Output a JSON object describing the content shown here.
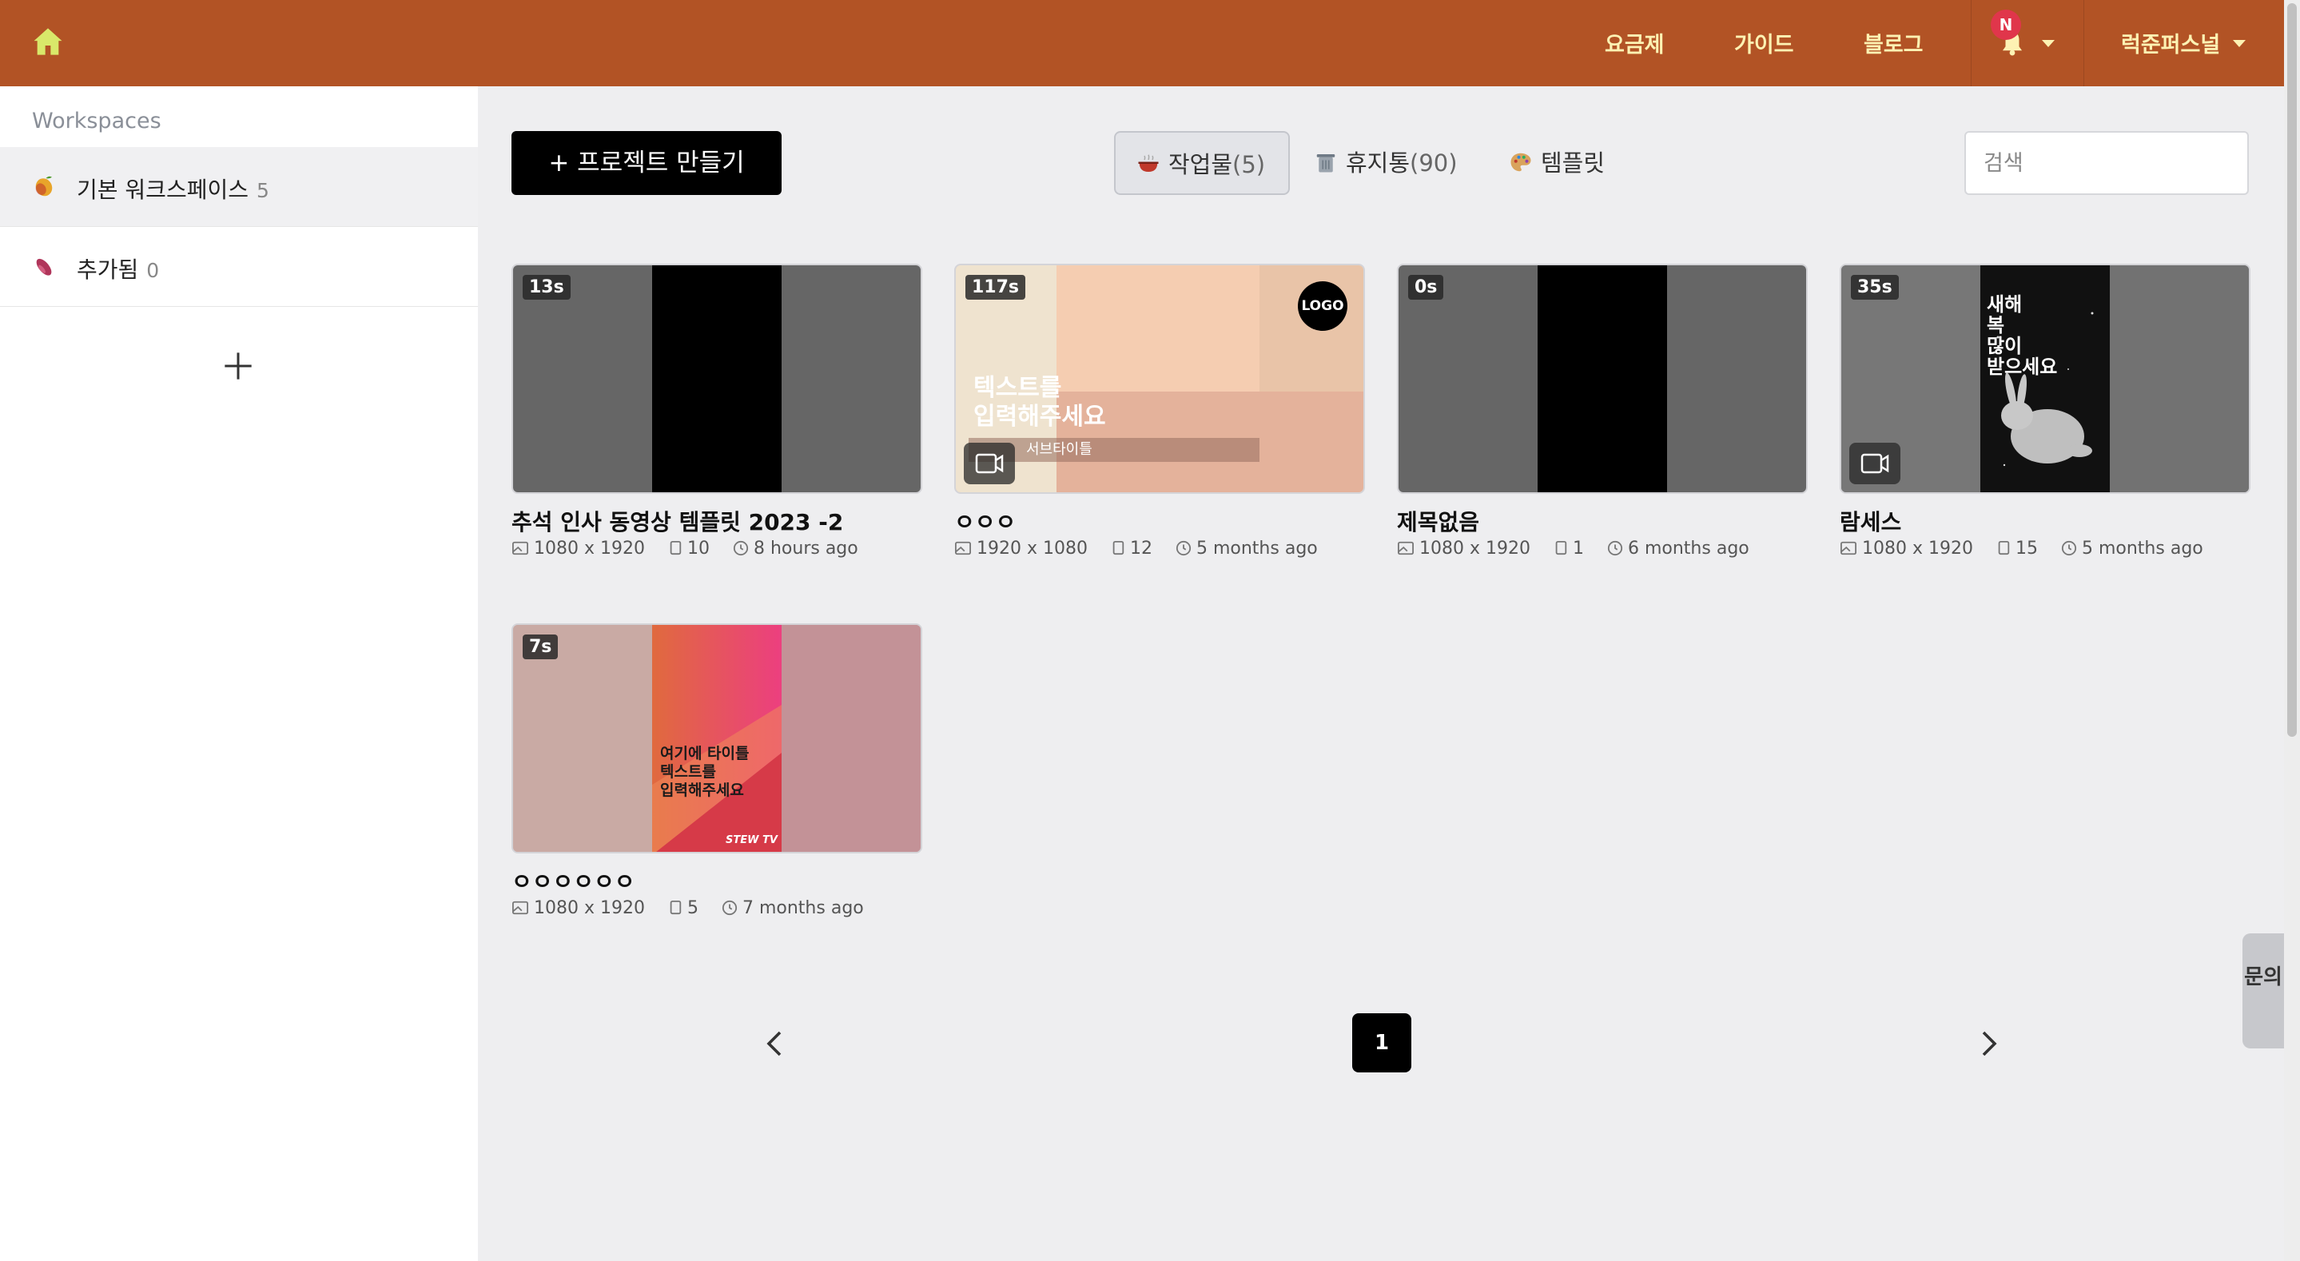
{
  "nav": {
    "home_icon": "home-icon",
    "links": [
      "요금제",
      "가이드",
      "블로그"
    ],
    "notification_badge": "N",
    "user_name": "럭준퍼스널"
  },
  "sidebar": {
    "title": "Workspaces",
    "items": [
      {
        "label": "기본 워크스페이스",
        "count": "5"
      },
      {
        "label": "추가됨",
        "count": "0"
      }
    ]
  },
  "toolbar": {
    "create_label": "+ 프로젝트 만들기",
    "tabs": [
      {
        "label": "작업물",
        "count": "(5)"
      },
      {
        "label": "휴지통",
        "count": "(90)"
      },
      {
        "label": "템플릿",
        "count": ""
      }
    ],
    "search_placeholder": "검색"
  },
  "projects": [
    {
      "duration": "13s",
      "title": "추석 인사 동영상 템플릿 2023 -2",
      "size": "1080 x 1920",
      "pages": "10",
      "time": "8 hours ago"
    },
    {
      "duration": "117s",
      "title": "ㅇㅇㅇ",
      "size": "1920 x 1080",
      "pages": "12",
      "time": "5 months ago",
      "thumb_text": "텍스트를\n입력해주세요",
      "thumb_sub": "서브타이틀",
      "logo": "LOGO"
    },
    {
      "duration": "0s",
      "title": "제목없음",
      "size": "1080 x 1920",
      "pages": "1",
      "time": "6 months ago"
    },
    {
      "duration": "35s",
      "title": "람세스",
      "size": "1080 x 1920",
      "pages": "15",
      "time": "5 months ago",
      "thumb_text": "새해\n복\n많이\n받으세요"
    },
    {
      "duration": "7s",
      "title": "ㅇㅇㅇㅇㅇㅇ",
      "size": "1080 x 1920",
      "pages": "5",
      "time": "7 months ago",
      "thumb_text": "여기에 타이틀\n텍스트를\n입력해주세요",
      "thumb_sub": "STEW TV"
    }
  ],
  "pagination": {
    "current": "1"
  },
  "inquiry_label": "문의",
  "colors": {
    "header": "#b25325",
    "nav_text": "#fdf2b3",
    "badge": "#e0364b"
  }
}
